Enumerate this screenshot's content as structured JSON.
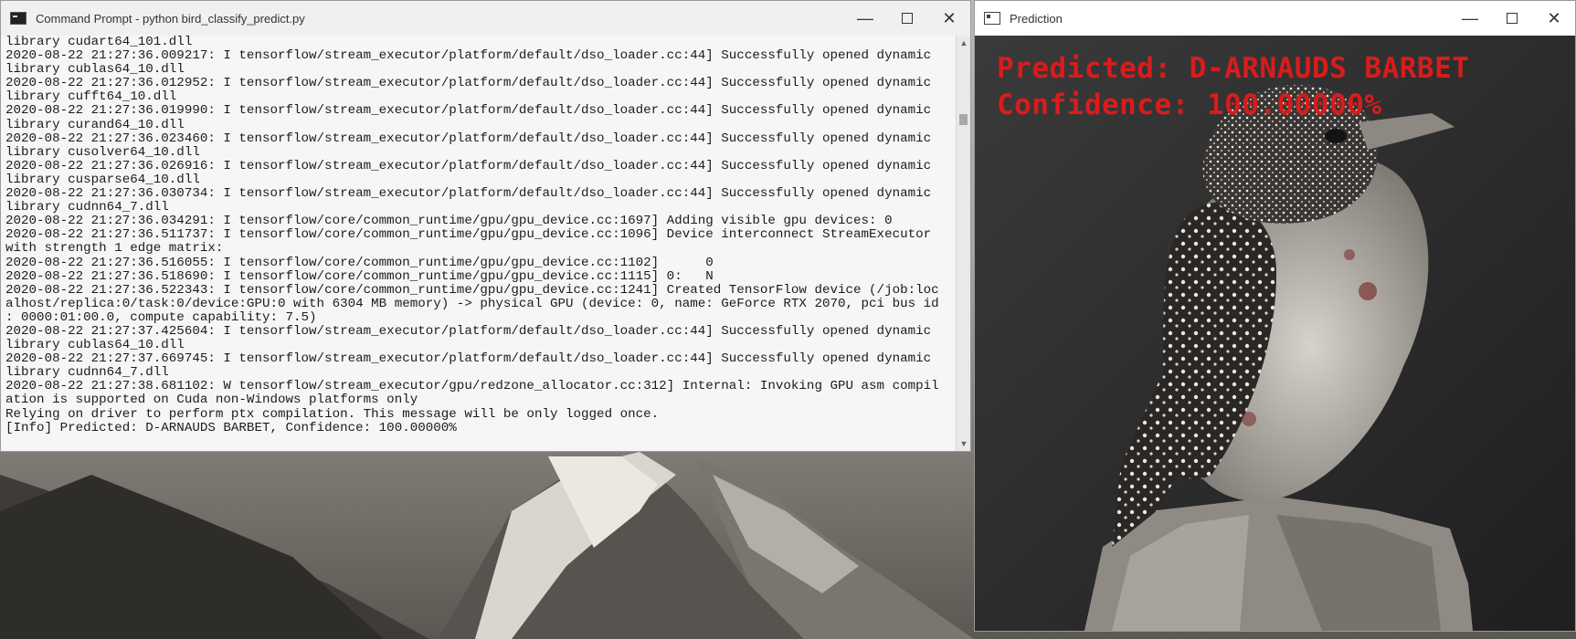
{
  "cmd_window": {
    "title": "Command Prompt - python  bird_classify_predict.py",
    "icon": "console-icon",
    "lines": [
      "library cudart64_101.dll",
      "2020-08-22 21:27:36.009217: I tensorflow/stream_executor/platform/default/dso_loader.cc:44] Successfully opened dynamic",
      "library cublas64_10.dll",
      "2020-08-22 21:27:36.012952: I tensorflow/stream_executor/platform/default/dso_loader.cc:44] Successfully opened dynamic",
      "library cufft64_10.dll",
      "2020-08-22 21:27:36.019990: I tensorflow/stream_executor/platform/default/dso_loader.cc:44] Successfully opened dynamic",
      "library curand64_10.dll",
      "2020-08-22 21:27:36.023460: I tensorflow/stream_executor/platform/default/dso_loader.cc:44] Successfully opened dynamic",
      "library cusolver64_10.dll",
      "2020-08-22 21:27:36.026916: I tensorflow/stream_executor/platform/default/dso_loader.cc:44] Successfully opened dynamic",
      "library cusparse64_10.dll",
      "2020-08-22 21:27:36.030734: I tensorflow/stream_executor/platform/default/dso_loader.cc:44] Successfully opened dynamic",
      "library cudnn64_7.dll",
      "2020-08-22 21:27:36.034291: I tensorflow/core/common_runtime/gpu/gpu_device.cc:1697] Adding visible gpu devices: 0",
      "2020-08-22 21:27:36.511737: I tensorflow/core/common_runtime/gpu/gpu_device.cc:1096] Device interconnect StreamExecutor",
      "with strength 1 edge matrix:",
      "2020-08-22 21:27:36.516055: I tensorflow/core/common_runtime/gpu/gpu_device.cc:1102]      0",
      "2020-08-22 21:27:36.518690: I tensorflow/core/common_runtime/gpu/gpu_device.cc:1115] 0:   N",
      "2020-08-22 21:27:36.522343: I tensorflow/core/common_runtime/gpu/gpu_device.cc:1241] Created TensorFlow device (/job:loc",
      "alhost/replica:0/task:0/device:GPU:0 with 6304 MB memory) -> physical GPU (device: 0, name: GeForce RTX 2070, pci bus id",
      ": 0000:01:00.0, compute capability: 7.5)",
      "2020-08-22 21:27:37.425604: I tensorflow/stream_executor/platform/default/dso_loader.cc:44] Successfully opened dynamic",
      "library cublas64_10.dll",
      "2020-08-22 21:27:37.669745: I tensorflow/stream_executor/platform/default/dso_loader.cc:44] Successfully opened dynamic",
      "library cudnn64_7.dll",
      "2020-08-22 21:27:38.681102: W tensorflow/stream_executor/gpu/redzone_allocator.cc:312] Internal: Invoking GPU asm compil",
      "ation is supported on Cuda non-Windows platforms only",
      "Relying on driver to perform ptx compilation. This message will be only logged once.",
      "[Info] Predicted: D-ARNAUDS BARBET, Confidence: 100.00000%"
    ]
  },
  "pred_window": {
    "title": "Prediction",
    "icon": "window-icon",
    "overlay": {
      "predicted": "Predicted: D-ARNAUDS BARBET",
      "confidence": "Confidence: 100.00000%"
    },
    "overlay_color": "#d81c1c"
  },
  "caption_buttons": {
    "minimize": "—",
    "close": "✕"
  },
  "scroll": {
    "up": "▲",
    "down": "▼"
  }
}
